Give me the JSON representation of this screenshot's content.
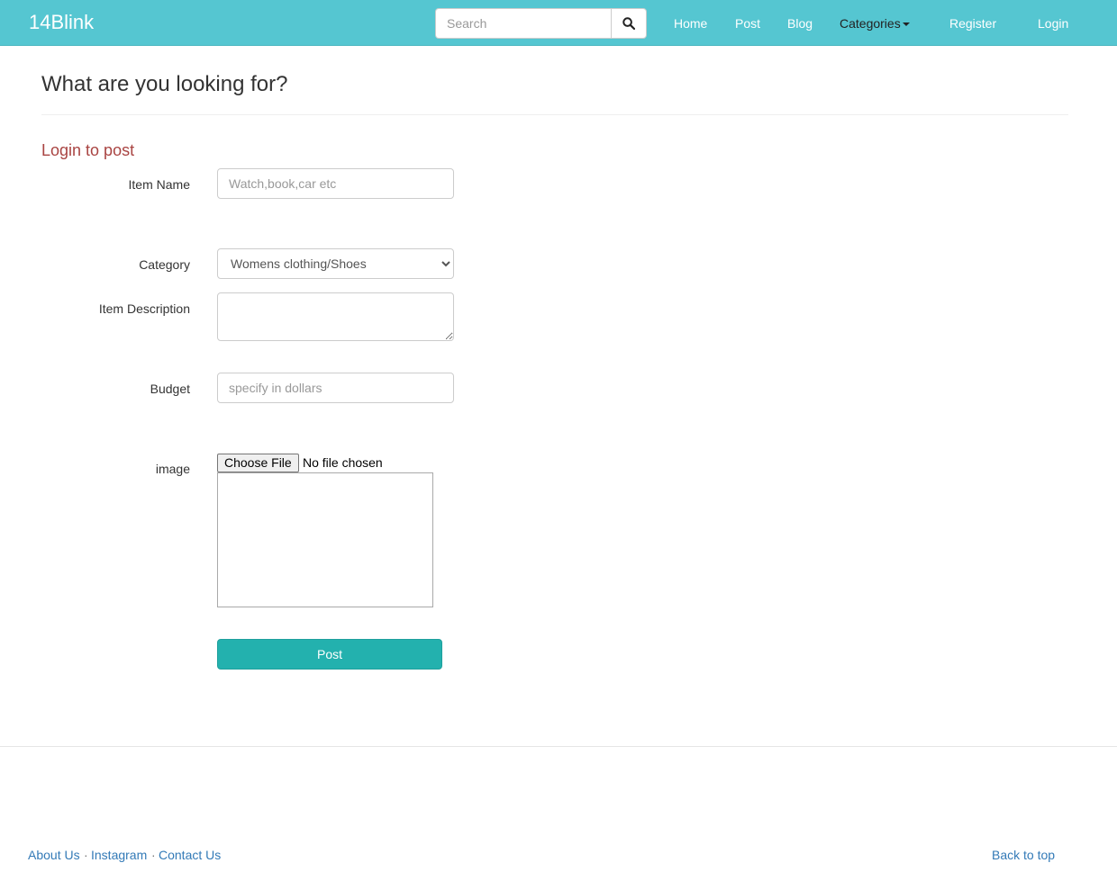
{
  "navbar": {
    "brand": "14Blink",
    "search": {
      "placeholder": "Search",
      "value": ""
    },
    "links": {
      "home": "Home",
      "post": "Post",
      "blog": "Blog",
      "categories": "Categories",
      "register": "Register",
      "login": "Login"
    },
    "colors": {
      "background": "#55c6d1"
    }
  },
  "main": {
    "title": "What are you looking for?",
    "notice": "Login to post",
    "form": {
      "item_name": {
        "label": "Item Name",
        "placeholder": "Watch,book,car etc",
        "value": ""
      },
      "category": {
        "label": "Category",
        "selected": "Womens clothing/Shoes"
      },
      "description": {
        "label": "Item Description",
        "value": ""
      },
      "budget": {
        "label": "Budget",
        "placeholder": "specify in dollars",
        "value": ""
      },
      "image": {
        "label": "image",
        "button": "Choose File",
        "status": "No file chosen"
      },
      "submit": "Post"
    },
    "colors": {
      "notice": "#a94442",
      "submit": "#23b1ae"
    }
  },
  "footer": {
    "links": {
      "about": "About Us",
      "instagram": "Instagram",
      "contact": "Contact Us"
    },
    "separator": "·",
    "back_to_top": "Back to top",
    "colors": {
      "link": "#337ab7"
    }
  }
}
